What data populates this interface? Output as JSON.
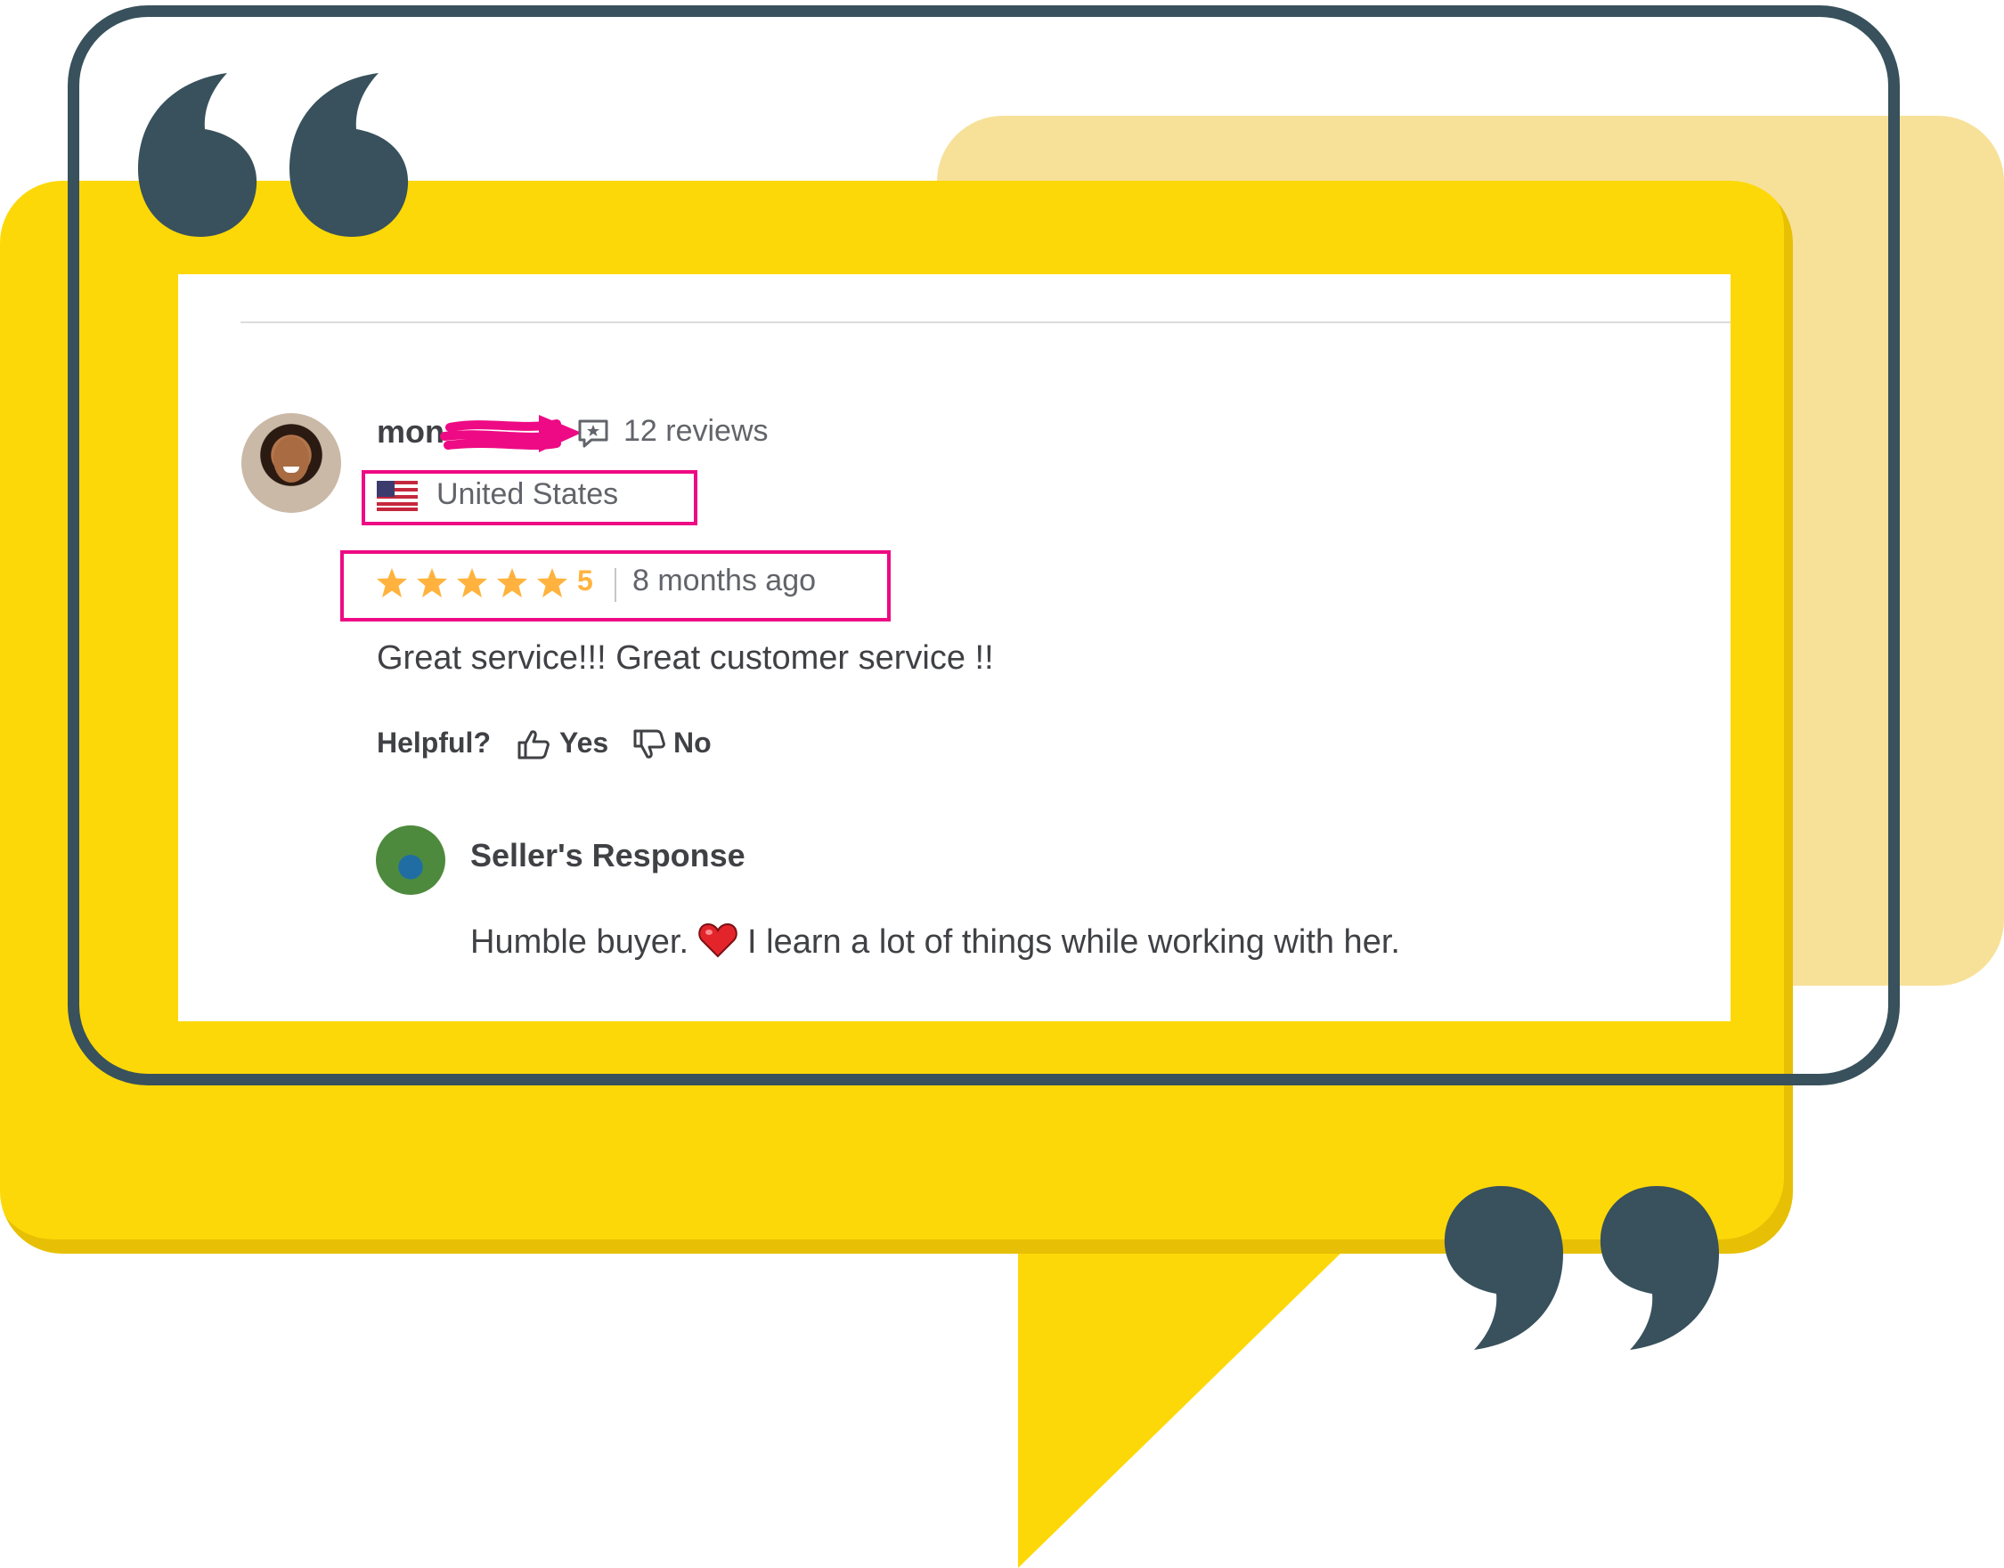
{
  "review": {
    "username": "mon",
    "reviews_count": "12 reviews",
    "country": "United States",
    "rating": "5",
    "time_ago": "8 months ago",
    "text": "Great service!!! Great customer service !!",
    "helpful_label": "Helpful?",
    "yes_label": "Yes",
    "no_label": "No"
  },
  "seller_response": {
    "title": "Seller's Response",
    "text_before": "Humble buyer.",
    "text_after": "I learn a lot of things while working with her."
  },
  "icons": {
    "quote_open": "quote-open-icon",
    "quote_close": "quote-close-icon",
    "reviews": "chat-star-icon",
    "flag": "us-flag-icon",
    "star": "star-icon",
    "thumb_up": "thumbs-up-icon",
    "thumb_down": "thumbs-down-icon",
    "heart": "heart-icon"
  },
  "colors": {
    "yellow": "#fdd808",
    "pale_yellow": "#f7e199",
    "slate": "#38515c",
    "highlight": "#ee0a84",
    "star": "#ffb33e",
    "text": "#404145",
    "muted_text": "#62646a"
  }
}
